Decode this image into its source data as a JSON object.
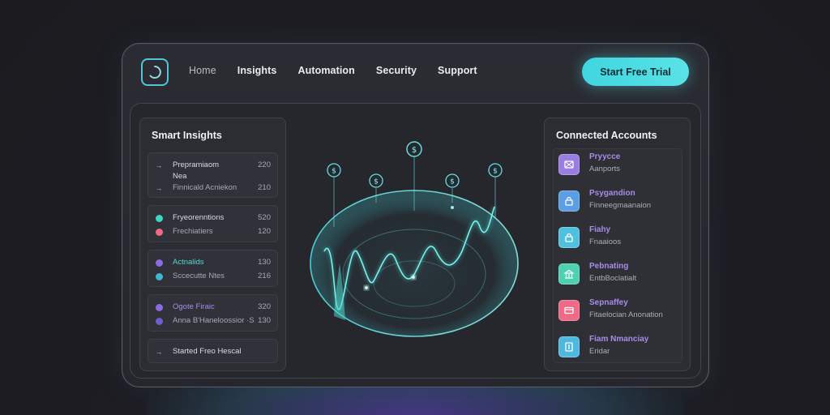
{
  "nav": {
    "items": [
      {
        "label": "Home",
        "active": false
      },
      {
        "label": "Insights",
        "active": true
      },
      {
        "label": "Automation",
        "active": true
      },
      {
        "label": "Security",
        "active": true
      },
      {
        "label": "Support",
        "active": true
      }
    ],
    "cta_label": "Start Free Trial"
  },
  "left_panel": {
    "title": "Smart Insights",
    "groups": [
      {
        "rows": [
          {
            "icon": "arrow-right-icon",
            "label": "Prepramiaom",
            "value": "220"
          },
          {
            "icon": "",
            "label": "Nea",
            "value": ""
          },
          {
            "icon": "arrow-right-icon",
            "label": "Finnicald Acniekon",
            "value": "210",
            "muted": true
          }
        ]
      },
      {
        "rows": [
          {
            "dot": "#3fd6c4",
            "label": "Fryeorenntions",
            "value": "520"
          },
          {
            "dot": "#f06a86",
            "label": "Frechiatiers",
            "value": "120",
            "muted": true
          }
        ]
      },
      {
        "rows": [
          {
            "dot": "#8a6be0",
            "label": "Actnalids",
            "value": "130",
            "accent": "#58d6d0"
          },
          {
            "dot": "#3fb6cc",
            "label": "Sccecutte Ntes",
            "value": "216",
            "muted": true
          }
        ]
      },
      {
        "rows": [
          {
            "dot": "#8a6be0",
            "label": "Ogote Firaic",
            "value": "320",
            "accent": "#a98be8"
          },
          {
            "dot": "#6a5fd0",
            "label": "Anna B'Haneloossior ·S",
            "value": "130",
            "muted": true
          }
        ]
      },
      {
        "rows": [
          {
            "icon": "arrow-right-icon",
            "label": "Started Freo Hescal",
            "value": ""
          }
        ]
      }
    ]
  },
  "right_panel": {
    "title": "Connected Accounts",
    "accounts": [
      {
        "name": "Pryycce",
        "desc": "Aanports",
        "color": "#9a7de0",
        "icon": "grid-icon"
      },
      {
        "name": "Psygandion",
        "desc": "Finneegmaanaion",
        "color": "#5a9ee6",
        "icon": "lock-icon"
      },
      {
        "name": "Fiahy",
        "desc": "Fnaaioos",
        "color": "#4fc0de",
        "icon": "lock-icon"
      },
      {
        "name": "Pebnating",
        "desc": "EntbBoclatialt",
        "color": "#4fd0b0",
        "icon": "bank-icon"
      },
      {
        "name": "Sepnaffey",
        "desc": "Fitaelocian Anonation",
        "color": "#ee6a86",
        "icon": "card-icon"
      },
      {
        "name": "Fiam Nmanciay",
        "desc": "Eridar",
        "color": "#4fb8de",
        "icon": "document-icon"
      }
    ]
  },
  "colors": {
    "accent_teal": "#4fd6dc",
    "accent_purple": "#a98be8"
  }
}
